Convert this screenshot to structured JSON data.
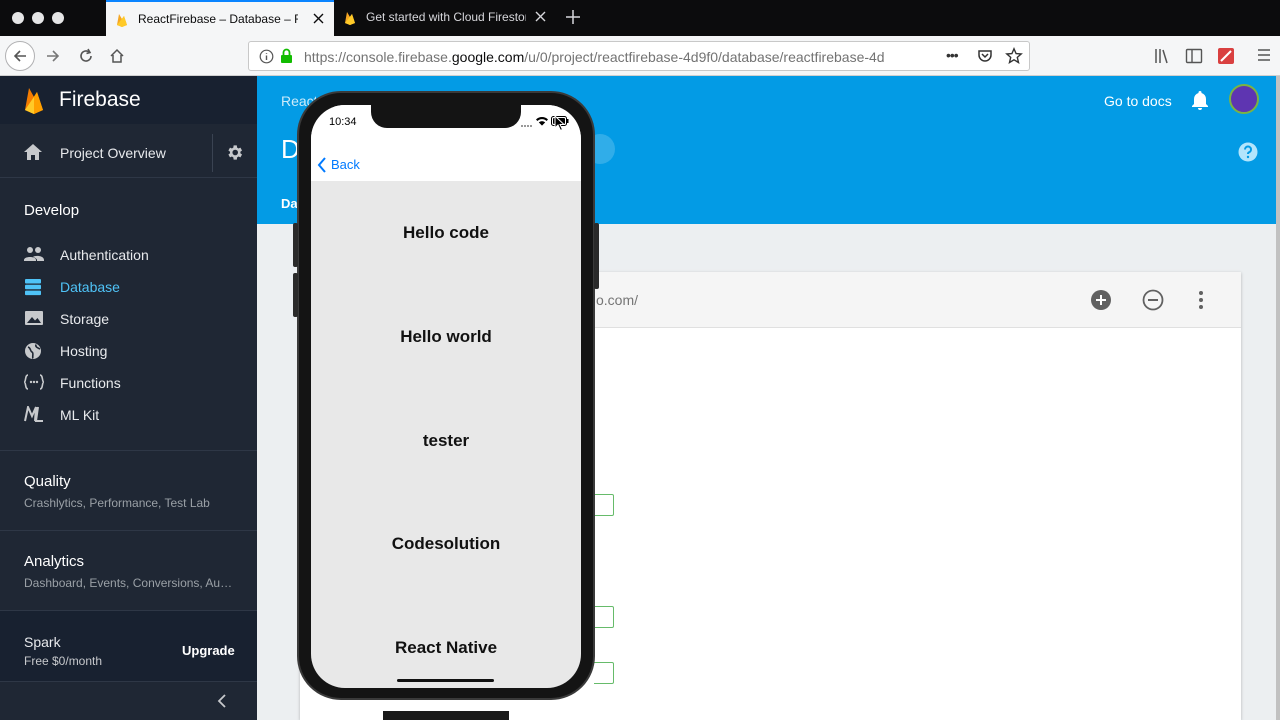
{
  "browser": {
    "tabs": [
      {
        "title": "ReactFirebase – Database – Fire",
        "active": true
      },
      {
        "title": "Get started with Cloud Firestore",
        "active": false
      }
    ],
    "url_prefix": "https://console.firebase.",
    "url_host": "google.com",
    "url_suffix": "/u/0/project/reactfirebase-4d9f0/database/reactfirebase-4d",
    "overflow_glyph": "•••"
  },
  "sidebar": {
    "brand": "Firebase",
    "project_overview": "Project Overview",
    "develop": {
      "title": "Develop",
      "items": [
        {
          "label": "Authentication",
          "icon": "people-icon"
        },
        {
          "label": "Database",
          "icon": "database-icon",
          "active": true
        },
        {
          "label": "Storage",
          "icon": "image-icon"
        },
        {
          "label": "Hosting",
          "icon": "globe-icon"
        },
        {
          "label": "Functions",
          "icon": "functions-icon"
        },
        {
          "label": "ML Kit",
          "icon": "mlkit-icon"
        }
      ]
    },
    "quality": {
      "title": "Quality",
      "subtitle": "Crashlytics, Performance, Test Lab"
    },
    "analytics": {
      "title": "Analytics",
      "subtitle": "Dashboard, Events, Conversions, Au…"
    },
    "plan": {
      "name": "Spark",
      "price": "Free $0/month",
      "upgrade": "Upgrade"
    }
  },
  "header": {
    "crumb": "React",
    "title": "D",
    "tab": "Da",
    "docs": "Go to docs"
  },
  "card": {
    "db_url": "o.com/"
  },
  "phone": {
    "time": "10:34",
    "back": "Back",
    "rows": [
      "Hello code",
      "Hello world",
      "tester",
      "Codesolution",
      "React Native"
    ]
  },
  "colors": {
    "header": "#039be5",
    "sidebar": "#1f2734",
    "active": "#4fc3f7",
    "ios_link": "#007aff"
  }
}
